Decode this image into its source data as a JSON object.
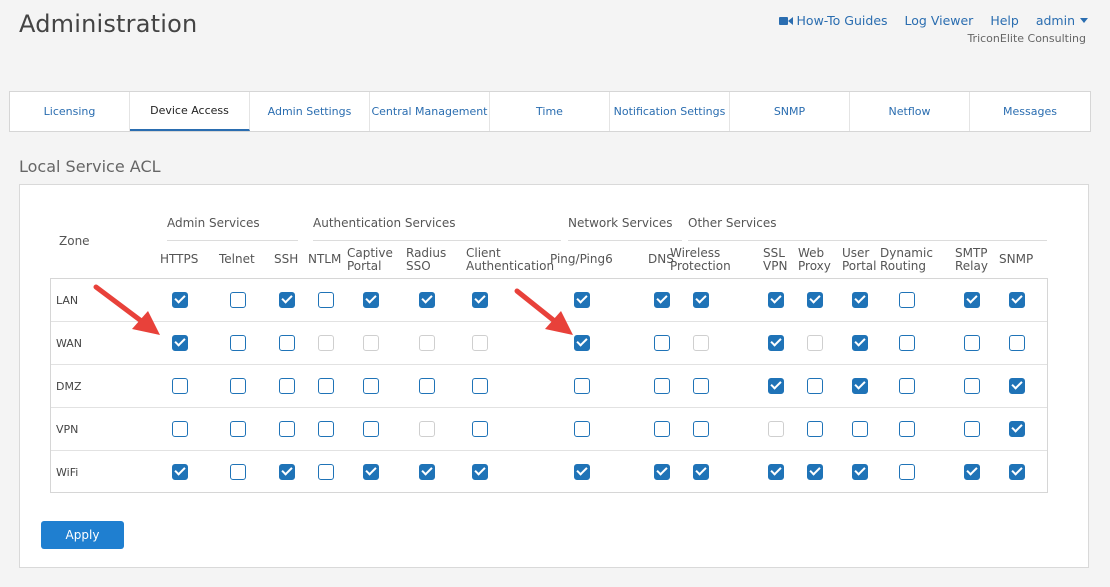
{
  "header": {
    "title": "Administration",
    "nav": [
      {
        "label": "How-To Guides",
        "icon": "video-camera-icon"
      },
      {
        "label": "Log Viewer"
      },
      {
        "label": "Help"
      },
      {
        "label": "admin",
        "has_dropdown": true
      }
    ],
    "org_name": "TriconElite Consulting"
  },
  "tabs": [
    {
      "label": "Licensing",
      "active": false
    },
    {
      "label": "Device Access",
      "active": true
    },
    {
      "label": "Admin Settings",
      "active": false
    },
    {
      "label": "Central Management",
      "active": false
    },
    {
      "label": "Time",
      "active": false
    },
    {
      "label": "Notification Settings",
      "active": false
    },
    {
      "label": "SNMP",
      "active": false
    },
    {
      "label": "Netflow",
      "active": false
    },
    {
      "label": "Messages",
      "active": false
    }
  ],
  "acl": {
    "title": "Local Service ACL",
    "zone_header": "Zone",
    "groups": [
      {
        "label": "Admin Services"
      },
      {
        "label": "Authentication Services"
      },
      {
        "label": "Network Services"
      },
      {
        "label": "Other Services"
      }
    ],
    "columns": [
      {
        "label": "HTTPS",
        "group": 0
      },
      {
        "label": "Telnet",
        "group": 0
      },
      {
        "label": "SSH",
        "group": 0
      },
      {
        "label": "NTLM",
        "group": 1
      },
      {
        "label": "Captive\nPortal",
        "group": 1
      },
      {
        "label": "Radius\nSSO",
        "group": 1
      },
      {
        "label": "Client\nAuthentication",
        "group": 1
      },
      {
        "label": "Ping/Ping6",
        "group": 2
      },
      {
        "label": "DNS",
        "group": 2
      },
      {
        "label": "Wireless\nProtection",
        "group": 3
      },
      {
        "label": "SSL\nVPN",
        "group": 3
      },
      {
        "label": "Web\nProxy",
        "group": 3
      },
      {
        "label": "User\nPortal",
        "group": 3
      },
      {
        "label": "Dynamic\nRouting",
        "group": 3
      },
      {
        "label": "SMTP\nRelay",
        "group": 3
      },
      {
        "label": "SNMP",
        "group": 3
      }
    ],
    "rows": [
      {
        "zone": "LAN",
        "states": [
          "on",
          "off",
          "on",
          "off",
          "on",
          "on",
          "on",
          "on",
          "on",
          "on",
          "on",
          "on",
          "on",
          "off",
          "on",
          "on"
        ]
      },
      {
        "zone": "WAN",
        "states": [
          "on",
          "off",
          "off",
          "disabled",
          "disabled",
          "disabled",
          "disabled",
          "on",
          "off",
          "disabled",
          "on",
          "disabled",
          "on",
          "off",
          "off",
          "off"
        ]
      },
      {
        "zone": "DMZ",
        "states": [
          "off",
          "off",
          "off",
          "off",
          "off",
          "off",
          "off",
          "off",
          "off",
          "off",
          "on",
          "off",
          "on",
          "off",
          "off",
          "on"
        ]
      },
      {
        "zone": "VPN",
        "states": [
          "off",
          "off",
          "off",
          "off",
          "off",
          "disabled",
          "off",
          "off",
          "off",
          "off",
          "disabled",
          "off",
          "off",
          "off",
          "off",
          "on"
        ]
      },
      {
        "zone": "WiFi",
        "states": [
          "on",
          "off",
          "on",
          "off",
          "on",
          "on",
          "on",
          "on",
          "on",
          "on",
          "on",
          "on",
          "on",
          "off",
          "on",
          "on"
        ]
      }
    ],
    "apply_label": "Apply",
    "checkbox_color": "#1f73b7"
  },
  "annotations": [
    {
      "icon": "red-arrow-icon",
      "target": "WAN HTTPS",
      "color": "#e8413a"
    },
    {
      "icon": "red-arrow-icon",
      "target": "WAN Ping/Ping6",
      "color": "#e8413a"
    }
  ]
}
